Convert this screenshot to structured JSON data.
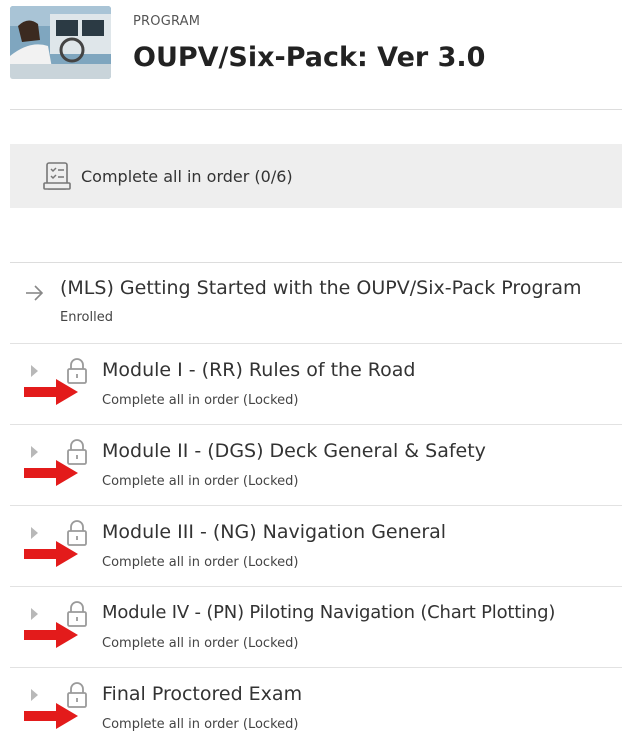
{
  "header": {
    "eyebrow": "PROGRAM",
    "title": "OUPV/Six-Pack: Ver 3.0",
    "thumbnail_icon": "boat-helm-photo"
  },
  "order_bar": {
    "icon": "checklist-icon",
    "label": "Complete all in order (0/6)"
  },
  "items": [
    {
      "icon": "arrow-right-icon",
      "title": "(MLS) Getting Started with the OUPV/Six-Pack Program",
      "status": "Enrolled",
      "locked": false
    },
    {
      "icon": "lock-icon",
      "title": "Module I - (RR) Rules of the Road",
      "status": "Complete all in order (Locked)",
      "locked": true
    },
    {
      "icon": "lock-icon",
      "title": "Module II - (DGS) Deck General & Safety",
      "status": "Complete all in order (Locked)",
      "locked": true
    },
    {
      "icon": "lock-icon",
      "title": "Module III - (NG) Navigation General",
      "status": "Complete all in order (Locked)",
      "locked": true
    },
    {
      "icon": "lock-icon",
      "title": "Module IV - (PN) Piloting Navigation (Chart Plotting)",
      "status": "Complete all in order (Locked)",
      "locked": true
    },
    {
      "icon": "lock-icon",
      "title": "Final Proctored Exam",
      "status": "Complete all in order (Locked)",
      "locked": true
    }
  ],
  "colors": {
    "annotation_arrow": "#e31b1b",
    "bar_background": "#eeeeee",
    "text": "#333333"
  }
}
